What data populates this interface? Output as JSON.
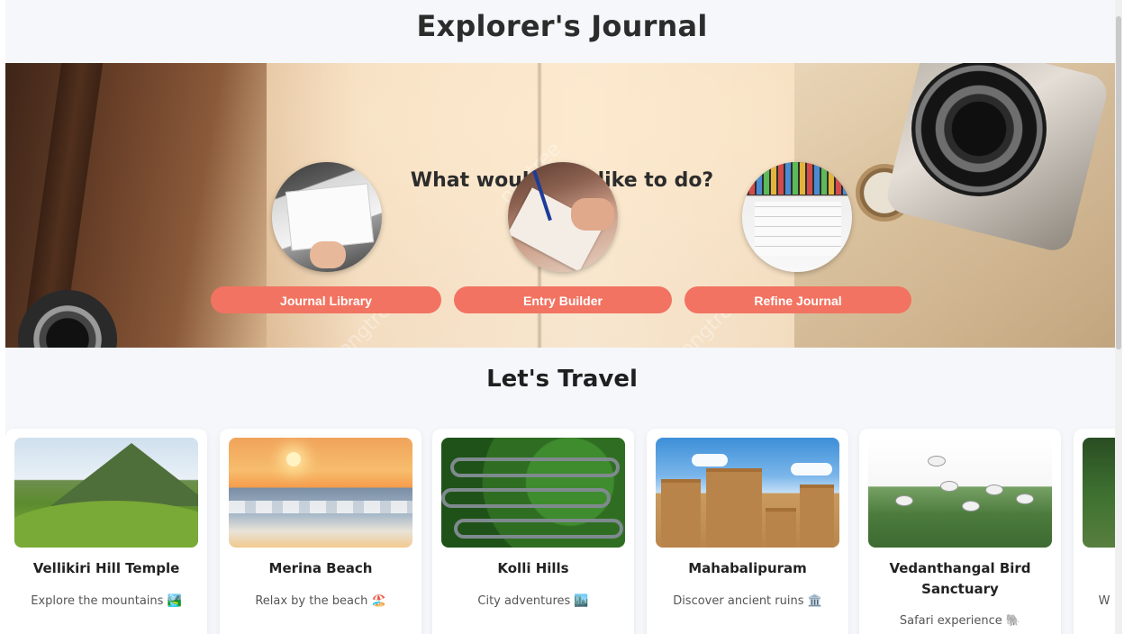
{
  "header": {
    "title": "Explorer's Journal"
  },
  "hero": {
    "heading": "What would you like to do?",
    "watermark_text": "pngtree",
    "actions": [
      {
        "label": "Journal Library",
        "image": "journal-library-image"
      },
      {
        "label": "Entry Builder",
        "image": "entry-builder-image"
      },
      {
        "label": "Refine Journal",
        "image": "refine-journal-image"
      }
    ],
    "button_color": "#f27361"
  },
  "travel": {
    "title": "Let's Travel",
    "cards": [
      {
        "name": "Vellikiri Hill Temple",
        "description": "Explore the mountains 🏞️"
      },
      {
        "name": "Merina Beach",
        "description": "Relax by the beach 🏖️"
      },
      {
        "name": "Kolli Hills",
        "description": "City adventures 🏙️"
      },
      {
        "name": "Mahabalipuram",
        "description": "Discover ancient ruins 🏛️"
      },
      {
        "name": "Vedanthangal Bird Sanctuary",
        "description": "Safari experience 🐘"
      },
      {
        "name": "",
        "description": "W"
      }
    ]
  }
}
